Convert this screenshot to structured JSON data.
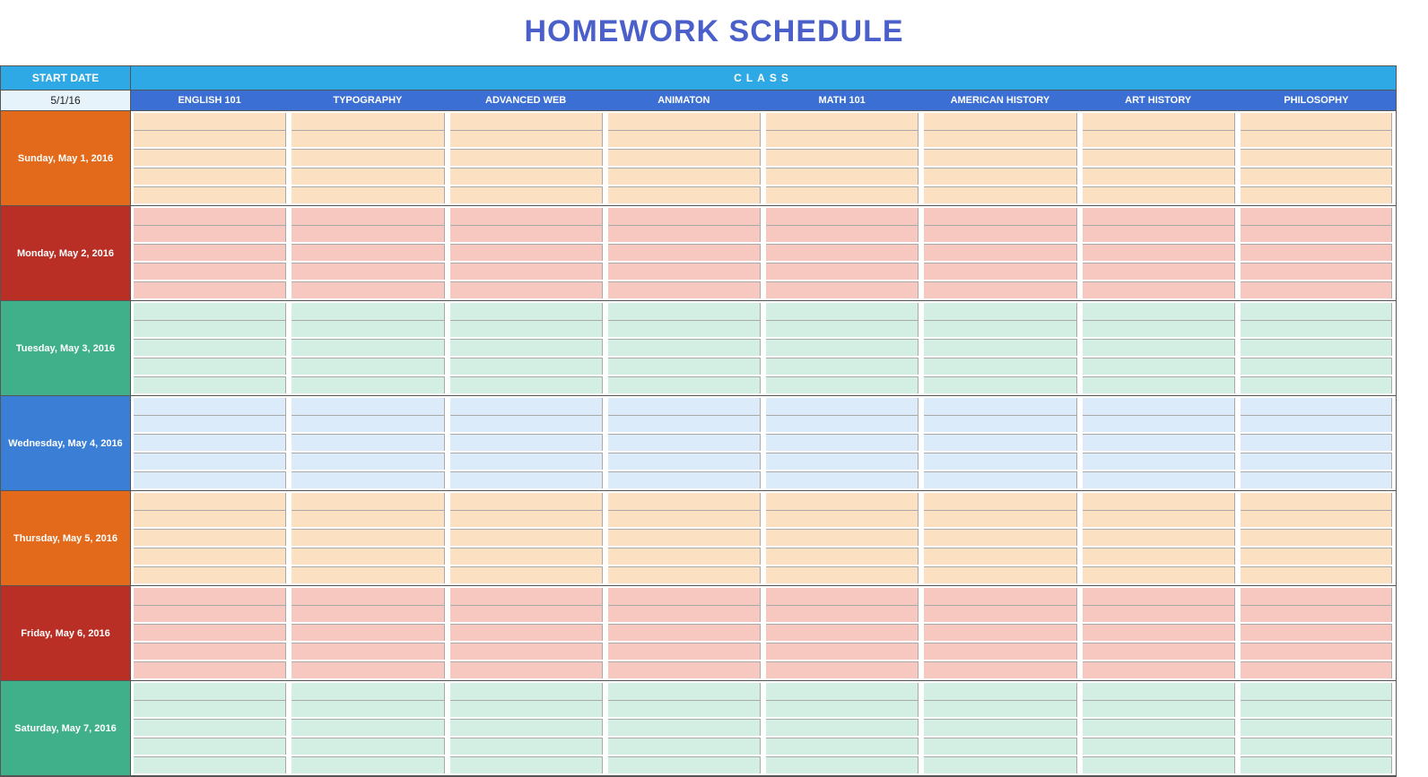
{
  "title": "HOMEWORK SCHEDULE",
  "header": {
    "start_date_label": "START DATE",
    "class_label": "CLASS",
    "start_date_value": "5/1/16",
    "columns": [
      "ENGLISH 101",
      "TYPOGRAPHY",
      "ADVANCED WEB",
      "ANIMATON",
      "MATH 101",
      "AMERICAN HISTORY",
      "ART HISTORY",
      "PHILOSOPHY"
    ]
  },
  "days": [
    {
      "label": "Sunday, May 1, 2016",
      "color": "orange"
    },
    {
      "label": "Monday, May 2, 2016",
      "color": "red"
    },
    {
      "label": "Tuesday, May 3, 2016",
      "color": "green"
    },
    {
      "label": "Wednesday, May 4, 2016",
      "color": "blue"
    },
    {
      "label": "Thursday, May 5, 2016",
      "color": "orange"
    },
    {
      "label": "Friday, May 6, 2016",
      "color": "red"
    },
    {
      "label": "Saturday, May 7, 2016",
      "color": "green"
    }
  ],
  "rows_per_day": 5
}
